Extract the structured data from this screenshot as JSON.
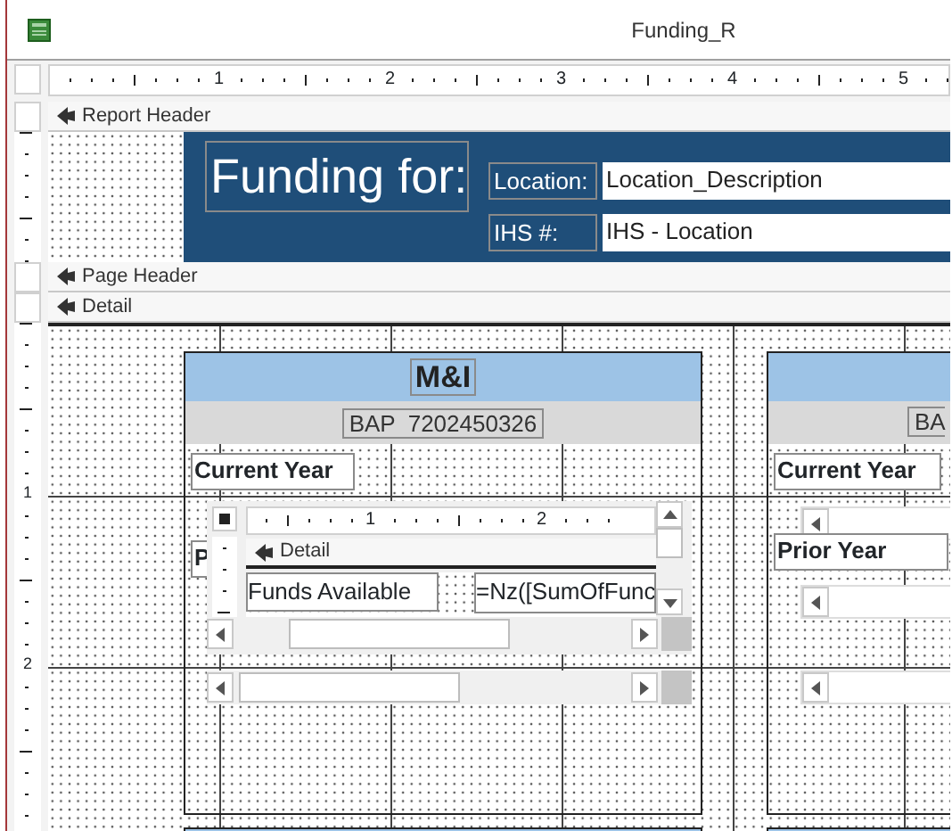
{
  "window": {
    "title": "Funding_R"
  },
  "ruler": {
    "labels": [
      "1",
      "2",
      "3",
      "4",
      "5"
    ]
  },
  "vertical_ruler": {
    "labels": [
      "1",
      "2"
    ]
  },
  "sections": [
    {
      "label": "Report Header"
    },
    {
      "label": "Page Header"
    },
    {
      "label": "Detail"
    }
  ],
  "report_header": {
    "title": "Funding for:",
    "fields": [
      {
        "label": "Location:",
        "value": "Location_Description"
      },
      {
        "label": "IHS #:",
        "value": "IHS - Location"
      }
    ]
  },
  "subreports": [
    {
      "title": "M&I",
      "code": "BAP  7202450326",
      "current_label": "Current Year",
      "prior_label": "P",
      "embedded": {
        "ruler_labels": [
          "1",
          "2"
        ],
        "section": "Detail",
        "label": "Funds Available",
        "expression": "=Nz([SumOfFunc"
      }
    },
    {
      "code": "BA",
      "current_label": "Current Year",
      "prior_label": "Prior Year"
    }
  ]
}
